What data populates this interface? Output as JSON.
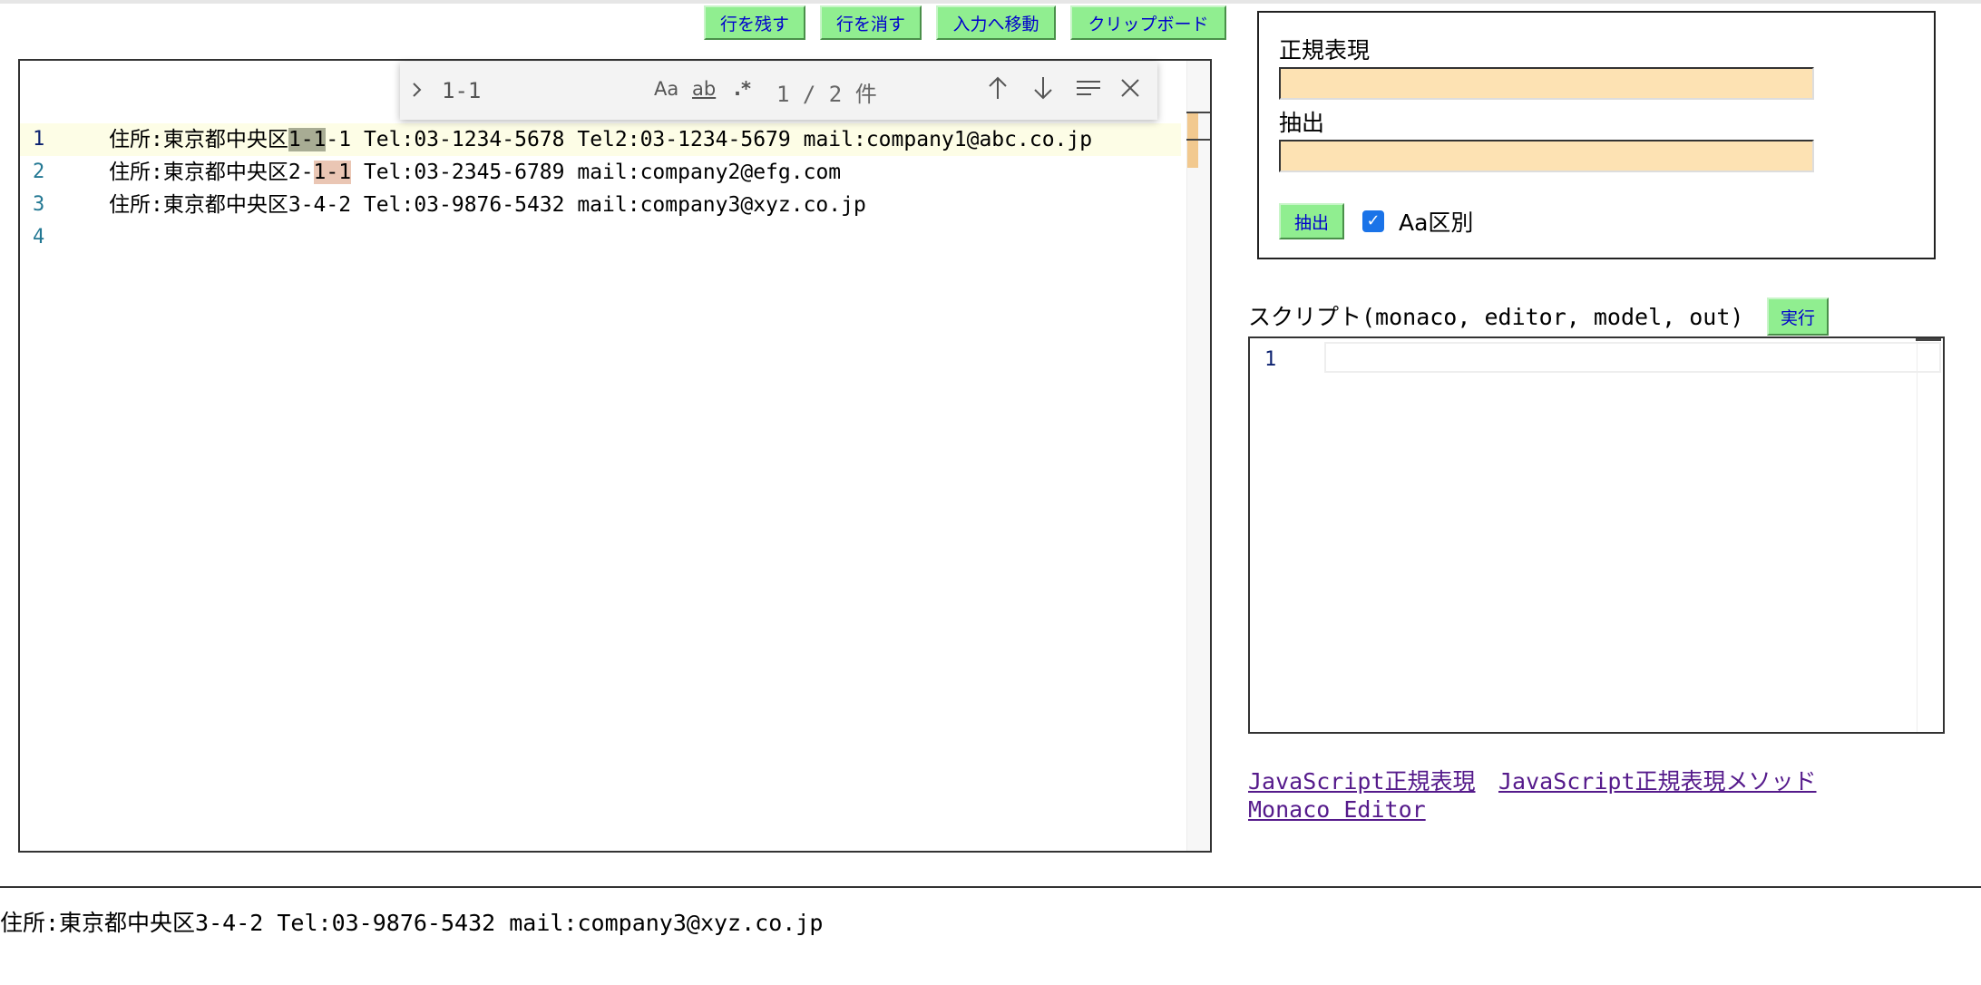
{
  "toolbar": {
    "keep_lines": "行を残す",
    "delete_lines": "行を消す",
    "move_to_input": "入力へ移動",
    "clipboard": "クリップボード"
  },
  "editor": {
    "lines": [
      {
        "num": "1",
        "pre": "住所:東京都中央区",
        "match": "1-1",
        "post": "-1 Tel:03-1234-5678 Tel2:03-1234-5679 mail:company1@abc.co.jp"
      },
      {
        "num": "2",
        "pre": "住所:東京都中央区2-",
        "match": "1-1",
        "post": " Tel:03-2345-6789 mail:company2@efg.com"
      },
      {
        "num": "3",
        "text": "住所:東京都中央区3-4-2 Tel:03-9876-5432 mail:company3@xyz.co.jp"
      },
      {
        "num": "4",
        "text": ""
      }
    ]
  },
  "find": {
    "toggle_icon": "chevron-right-icon",
    "query": "1-1",
    "match_case": "Aa",
    "whole_word": "ab",
    "regex": ".*",
    "count": "1 / 2 件"
  },
  "regex_panel": {
    "regex_label": "正規表現",
    "regex_value": "",
    "extract_label": "抽出",
    "extract_value": "",
    "extract_button": "抽出",
    "case_checked": true,
    "case_label": "Aa区別"
  },
  "script": {
    "label": "スクリプト(monaco, editor, model, out)",
    "run_button": "実行",
    "line_number": "1"
  },
  "links": {
    "js_regex": "JavaScript正規表現",
    "js_regex_methods": "JavaScript正規表現メソッド",
    "monaco": "Monaco Editor"
  },
  "output": {
    "text": "住所:東京都中央区3-4-2 Tel:03-9876-5432 mail:company3@xyz.co.jp"
  },
  "colors": {
    "button_bg": "#90ee90",
    "button_text": "#0000cc",
    "input_bg": "#fde2b3",
    "current_match": "#a8ac94",
    "other_match": "#eac6b4",
    "link": "#551a8b"
  }
}
